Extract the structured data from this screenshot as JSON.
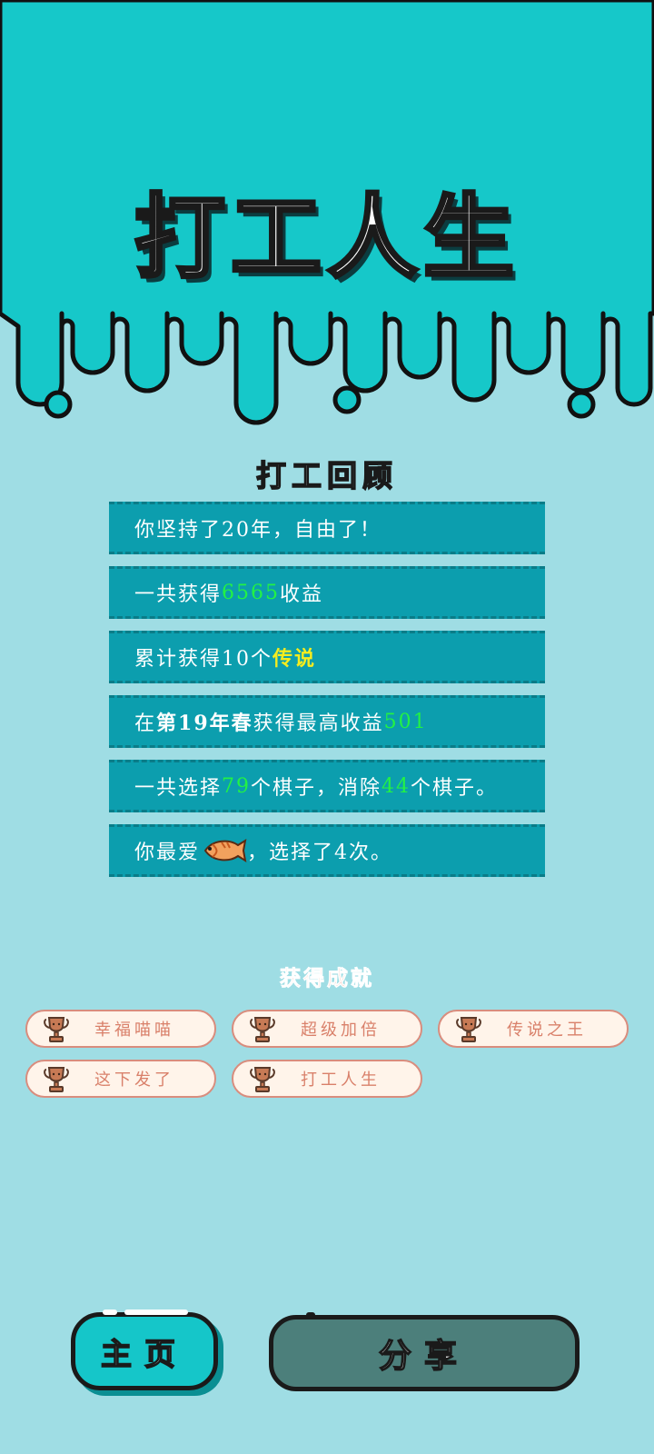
{
  "title": "打工人生",
  "review": {
    "heading": "打工回顾",
    "rows": [
      {
        "parts": [
          "你坚持了20年，自由了！"
        ]
      },
      {
        "parts": [
          "一共获得",
          "6565",
          "收益"
        ]
      },
      {
        "parts": [
          "累计获得10个",
          "传说"
        ]
      },
      {
        "parts": [
          "在 ",
          "第19年春",
          " 获得最高收益",
          "501"
        ]
      },
      {
        "parts": [
          "一共选择",
          "79",
          "个棋子，消除",
          "44",
          "个棋子。"
        ]
      },
      {
        "parts": [
          "你最爱",
          "，选择了4次。"
        ],
        "icon": "fish-icon"
      }
    ]
  },
  "achievements": {
    "heading": "获得成就",
    "items": [
      "幸福喵喵",
      "超级加倍",
      "传说之王",
      "这下发了",
      "打工人生"
    ],
    "icon": "trophy-icon"
  },
  "buttons": {
    "home": "主页",
    "share": "分享"
  },
  "colors": {
    "top_background": "#16c8c9",
    "page_background": "#9fdde4",
    "row_background": "#0c9eae",
    "highlight_green": "#22f244",
    "highlight_yellow": "#f5ec1e",
    "badge_text": "#d9806a",
    "home_button": "#15c6c9",
    "share_button": "#4c7f7b"
  }
}
